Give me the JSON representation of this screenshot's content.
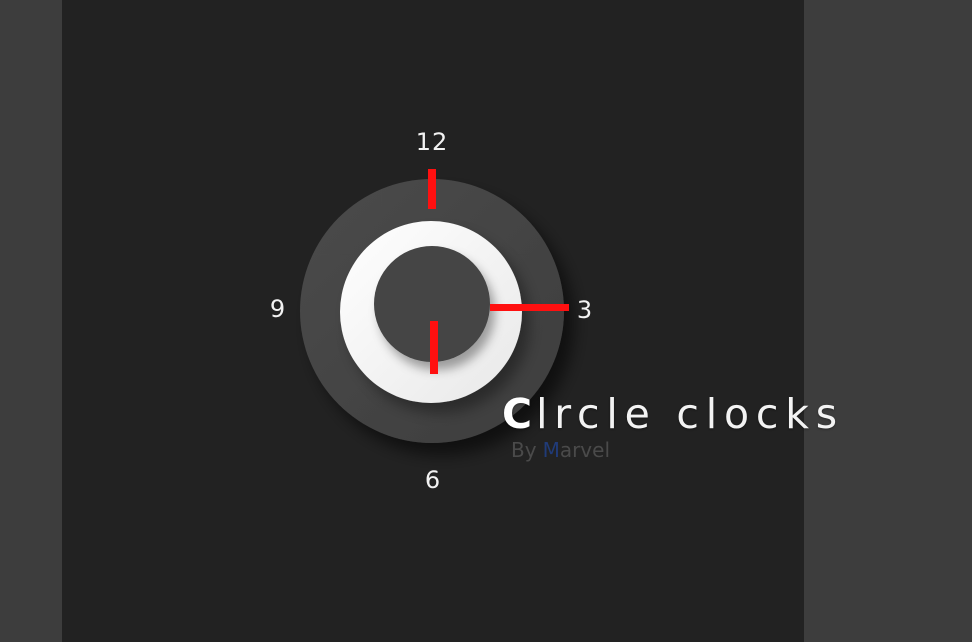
{
  "clock": {
    "numerals": {
      "twelve": "12",
      "three": "3",
      "six": "6",
      "nine": "9"
    }
  },
  "title": {
    "first_letter": "C",
    "rest": "lrcle clocks"
  },
  "byline": {
    "prefix": "By",
    "accent_letter": "M",
    "rest": "arvel"
  },
  "colors": {
    "background": "#3d3d3d",
    "panel": "#222222",
    "dial_outer": "#454545",
    "dial_ring": "#f2f2f2",
    "dial_inner": "#454545",
    "hands": "#ff1010",
    "accent_blue": "#203b78"
  }
}
